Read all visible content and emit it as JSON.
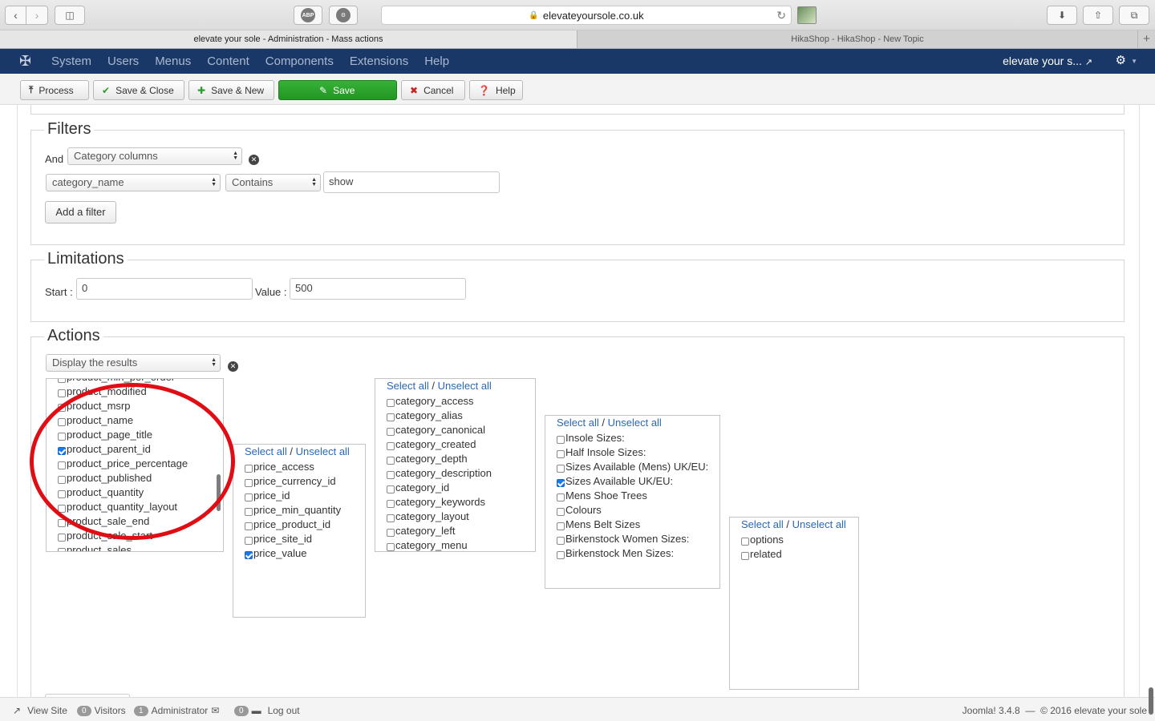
{
  "browser": {
    "url": "elevateyoursole.co.uk",
    "ext_abp": "ABP",
    "tabs": [
      {
        "title": "elevate your sole - Administration - Mass actions",
        "active": true
      },
      {
        "title": "HikaShop - HikaShop - New Topic",
        "active": false
      }
    ]
  },
  "admin_nav": {
    "menu": [
      "System",
      "Users",
      "Menus",
      "Content",
      "Components",
      "Extensions",
      "Help"
    ],
    "site_name": "elevate your s..."
  },
  "toolbar": {
    "process": "Process",
    "save_close": "Save & Close",
    "save_new": "Save & New",
    "save": "Save",
    "cancel": "Cancel",
    "help": "Help"
  },
  "filters": {
    "legend": "Filters",
    "and_label": "And",
    "type_select": "Category columns",
    "column_select": "category_name",
    "operator_select": "Contains",
    "value": "show",
    "add_filter": "Add a filter"
  },
  "limitations": {
    "legend": "Limitations",
    "start_label": "Start :",
    "start_value": "0",
    "value_label": "Value :",
    "value_value": "500"
  },
  "actions": {
    "legend": "Actions",
    "action_select": "Display the results",
    "select_all": "Select all",
    "separator": "/",
    "unselect_all": "Unselect all",
    "product_list": [
      {
        "label": "product_min_per_order",
        "checked": false
      },
      {
        "label": "product_modified",
        "checked": false
      },
      {
        "label": "product_msrp",
        "checked": false
      },
      {
        "label": "product_name",
        "checked": false
      },
      {
        "label": "product_page_title",
        "checked": false
      },
      {
        "label": "product_parent_id",
        "checked": true
      },
      {
        "label": "product_price_percentage",
        "checked": false
      },
      {
        "label": "product_published",
        "checked": false
      },
      {
        "label": "product_quantity",
        "checked": false
      },
      {
        "label": "product_quantity_layout",
        "checked": false
      },
      {
        "label": "product_sale_end",
        "checked": false
      },
      {
        "label": "product_sale_start",
        "checked": false
      },
      {
        "label": "product_sales",
        "checked": false
      }
    ],
    "price_list": [
      {
        "label": "price_access",
        "checked": false
      },
      {
        "label": "price_currency_id",
        "checked": false
      },
      {
        "label": "price_id",
        "checked": false
      },
      {
        "label": "price_min_quantity",
        "checked": false
      },
      {
        "label": "price_product_id",
        "checked": false
      },
      {
        "label": "price_site_id",
        "checked": false
      },
      {
        "label": "price_value",
        "checked": true
      }
    ],
    "category_list": [
      {
        "label": "category_access",
        "checked": false
      },
      {
        "label": "category_alias",
        "checked": false
      },
      {
        "label": "category_canonical",
        "checked": false
      },
      {
        "label": "category_created",
        "checked": false
      },
      {
        "label": "category_depth",
        "checked": false
      },
      {
        "label": "category_description",
        "checked": false
      },
      {
        "label": "category_id",
        "checked": false
      },
      {
        "label": "category_keywords",
        "checked": false
      },
      {
        "label": "category_layout",
        "checked": false
      },
      {
        "label": "category_left",
        "checked": false
      },
      {
        "label": "category_menu",
        "checked": false
      }
    ],
    "characteristic_list": [
      {
        "label": "Insole Sizes:",
        "checked": false
      },
      {
        "label": "Half Insole Sizes:",
        "checked": false
      },
      {
        "label": "Sizes Available (Mens) UK/EU:",
        "checked": false
      },
      {
        "label": "Sizes Available UK/EU:",
        "checked": true
      },
      {
        "label": "Mens Shoe Trees",
        "checked": false
      },
      {
        "label": "Colours",
        "checked": false
      },
      {
        "label": "Mens Belt Sizes",
        "checked": false
      },
      {
        "label": "Birkenstock Women Sizes:",
        "checked": false
      },
      {
        "label": "Birkenstock Men Sizes:",
        "checked": false
      }
    ],
    "related_list": [
      {
        "label": "options",
        "checked": false
      },
      {
        "label": "related",
        "checked": false
      }
    ]
  },
  "status_bar": {
    "view_site": "View Site",
    "visitors_count": "0",
    "visitors_label": "Visitors",
    "admin_count": "1",
    "admin_label": "Administrator",
    "messages_count": "0",
    "logout": "Log out",
    "version": "Joomla! 3.4.8",
    "dash": "—",
    "copyright": "© 2016 elevate your sole"
  }
}
